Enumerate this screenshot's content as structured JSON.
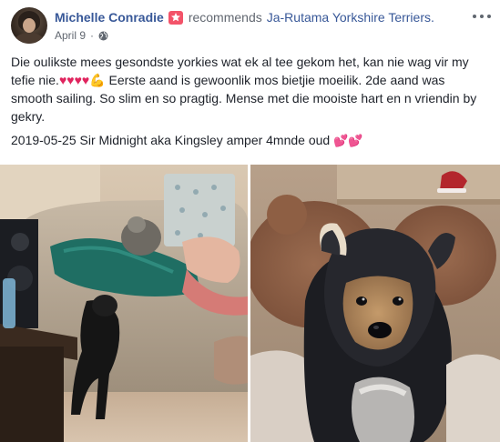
{
  "post": {
    "author": "Michelle Conradie",
    "recommends_text": "recommends",
    "page_name": "Ja-Rutama Yorkshire Terriers.",
    "date": "April 9",
    "separator": "·",
    "privacy_icon": "globe-icon",
    "more_icon": "more-options-icon",
    "recommend_icon": "recommendation-star-icon",
    "accent_color": "#385898",
    "recommend_color": "#f35369",
    "body_line1": "Die oulikste mees gesondste yorkies wat ek al tee gekom het, kan nie wag vir my tefie nie.",
    "body_emoji_hearts": "♥♥♥♥",
    "body_emoji_arm": "💪",
    "body_line1_rest": " Eerste aand is gewoonlik mos bietjie moeilik. 2de aand was smooth sailing. So slim en so pragtig. Mense met die mooiste hart en n vriendin by gekry.",
    "body_line2": "2019-05-25 Sir Midnight aka Kingsley amper 4mnde oud",
    "body_line2_emoji": "💕💕"
  },
  "photos": [
    {
      "description_icon": "photo-living-room-puppy"
    },
    {
      "description_icon": "photo-puppy-closeup"
    }
  ]
}
